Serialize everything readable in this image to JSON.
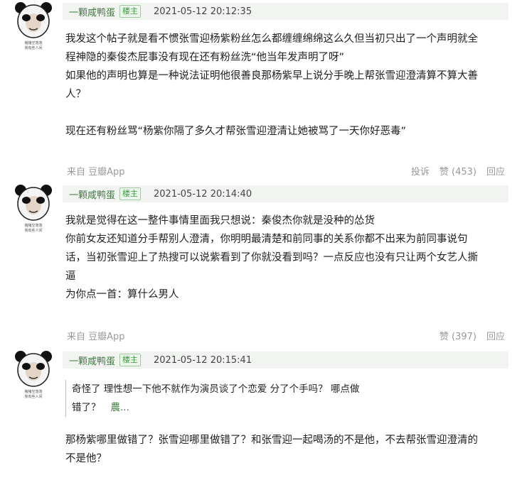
{
  "avatar_caption": [
    "猪猪空落落",
    "我有些人间"
  ],
  "comments": [
    {
      "author": "一颗咸鸭蛋",
      "badge": "楼主",
      "time": "2021-05-12 20:12:35",
      "lines": [
        "我发这个帖子就是看不惯张雪迎杨紫粉丝怎么都缠缠绵绵这么久但当初只出了一个声明就全",
        "程神隐的秦俊杰屁事没有现在还有粉丝洗“他当年发声明了呀”",
        "如果他的声明也算是一种说法证明他很善良那杨紫早上说分手晚上帮张雪迎澄清算不算大善",
        "人？",
        "",
        "现在还有粉丝骂“杨紫你隔了多久才帮张雪迎澄清让她被骂了一天你好恶毒”"
      ],
      "footer": {
        "from": "来自 豆瓣App",
        "report": "投诉",
        "like": "赞 (453)",
        "reply": "回应"
      }
    },
    {
      "author": "一颗咸鸭蛋",
      "badge": "楼主",
      "time": "2021-05-12 20:14:40",
      "lines": [
        "我就是觉得在这一整件事情里面我只想说：秦俊杰你就是没种的怂货",
        "你前女友还知道分手帮别人澄清，你明明最清楚和前同事的关系你都不出来为前同事说句",
        "话，当初张雪迎上了热搜可以说紫看到了你就没看到吗？一点反应也没有只让两个女艺人撕",
        "逼",
        "为你点一首：算什么男人"
      ],
      "footer": {
        "from": "来自 豆瓣App",
        "like": "赞 (397)",
        "reply": "回应"
      }
    },
    {
      "author": "一颗咸鸭蛋",
      "badge": "楼主",
      "time": "2021-05-12 20:15:41",
      "quote": {
        "line1": "奇怪了 理性想一下他不就作为演员谈了个恋爱 分了个手吗？ 哪点做",
        "line2": "错了？",
        "author": "農..."
      },
      "lines": [
        "那杨紫哪里做错了？张雪迎哪里做错了？和张雪迎一起喝汤的不是他，不去帮张雪迎澄清的",
        "不是他？"
      ]
    }
  ]
}
